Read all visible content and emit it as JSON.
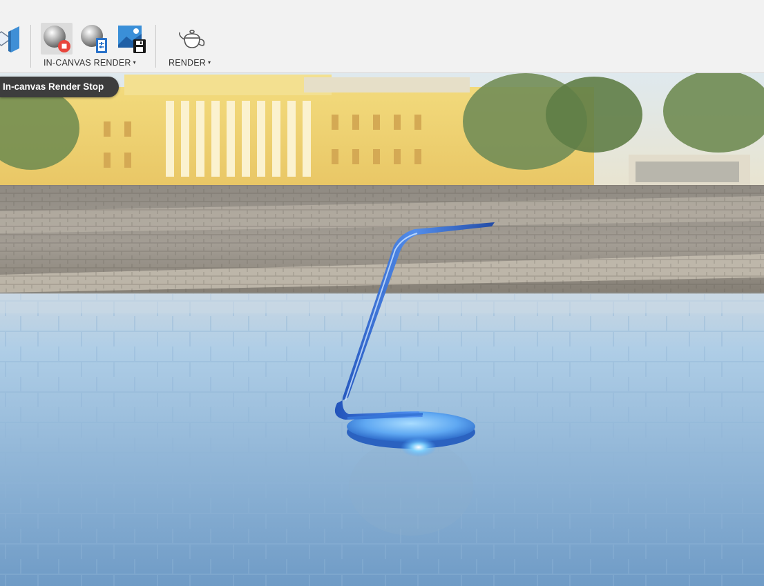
{
  "toolbar": {
    "groups": [
      {
        "label": "IN-CANVAS RENDER",
        "dropdown": true
      },
      {
        "label": "RENDER",
        "dropdown": true
      }
    ],
    "buttons": [
      {
        "name": "scene-settings",
        "icon": "scene-settings-icon"
      },
      {
        "name": "in-canvas-render-stop",
        "icon": "render-stop-icon",
        "active": true
      },
      {
        "name": "in-canvas-render-settings",
        "icon": "render-settings-icon"
      },
      {
        "name": "capture-image",
        "icon": "capture-image-icon"
      },
      {
        "name": "render",
        "icon": "teapot-icon"
      }
    ],
    "caret": "▾"
  },
  "tooltip": {
    "text": "In-canvas Render Stop"
  },
  "colors": {
    "toolbar_bg": "#f2f2f2",
    "tooltip_bg": "#3d3d3d",
    "stop_red": "#e8453c",
    "model_blue": "#2f6fe0"
  }
}
